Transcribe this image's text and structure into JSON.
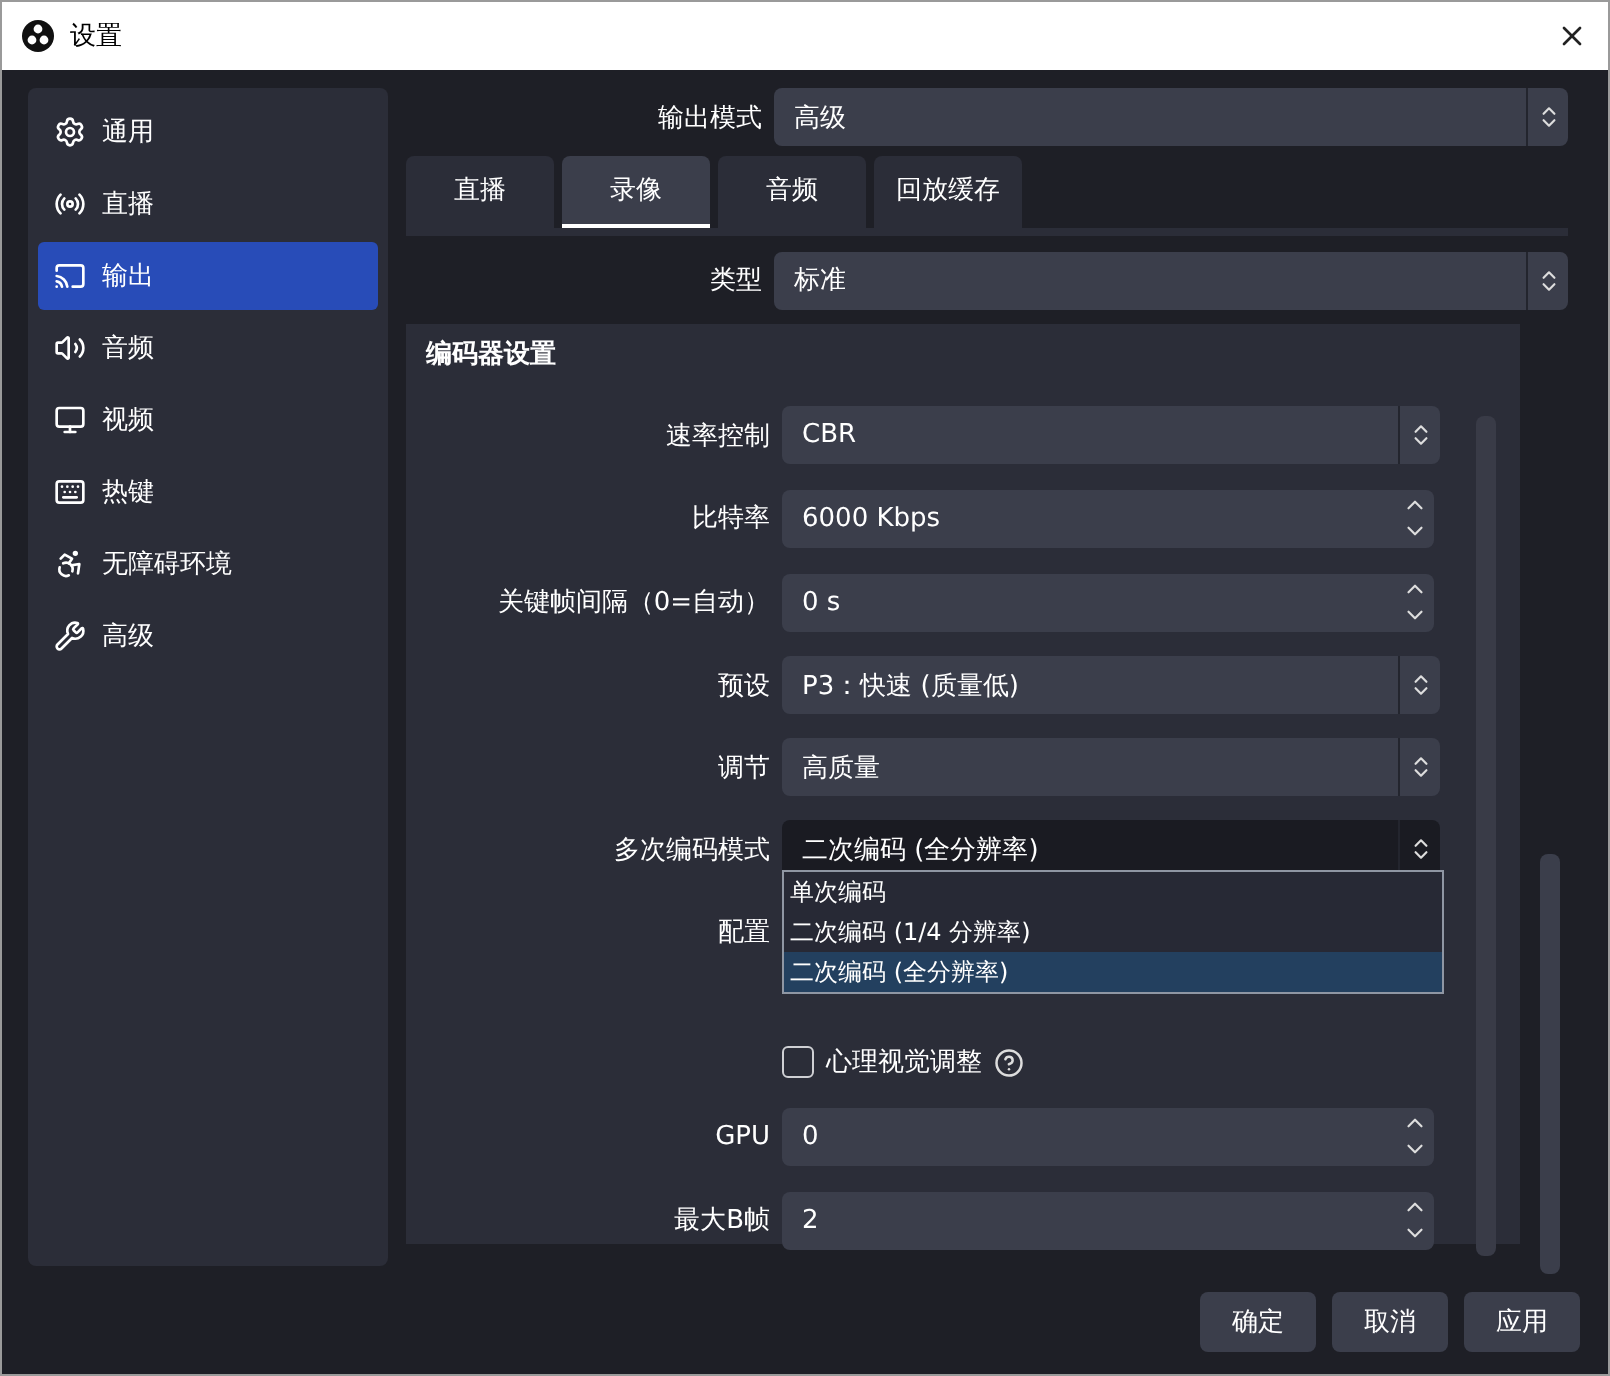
{
  "window": {
    "title": "设置"
  },
  "sidebar": {
    "items": [
      {
        "label": "通用",
        "selected": false
      },
      {
        "label": "直播",
        "selected": false
      },
      {
        "label": "输出",
        "selected": true
      },
      {
        "label": "音频",
        "selected": false
      },
      {
        "label": "视频",
        "selected": false
      },
      {
        "label": "热键",
        "selected": false
      },
      {
        "label": "无障碍环境",
        "selected": false
      },
      {
        "label": "高级",
        "selected": false
      }
    ]
  },
  "output_mode": {
    "label": "输出模式",
    "value": "高级"
  },
  "tabs": [
    {
      "label": "直播",
      "selected": false
    },
    {
      "label": "录像",
      "selected": true
    },
    {
      "label": "音频",
      "selected": false
    },
    {
      "label": "回放缓存",
      "selected": false
    }
  ],
  "type": {
    "label": "类型",
    "value": "标准"
  },
  "encoder_group": {
    "title": "编码器设置",
    "rows": [
      {
        "kind": "select",
        "label": "速率控制",
        "value": "CBR"
      },
      {
        "kind": "spin",
        "label": "比特率",
        "value": "6000 Kbps"
      },
      {
        "kind": "spin",
        "label": "关键帧间隔（0=自动）",
        "value": "0 s"
      },
      {
        "kind": "select",
        "label": "预设",
        "value": "P3：快速 (质量低)"
      },
      {
        "kind": "select",
        "label": "调节",
        "value": "高质量"
      },
      {
        "kind": "select",
        "label": "多次编码模式",
        "value": "二次编码 (全分辨率)",
        "open": true
      },
      {
        "kind": "covered",
        "label": "配置"
      },
      {
        "kind": "checkbox",
        "label": "心理视觉调整",
        "checked": false
      },
      {
        "kind": "spin",
        "label": "GPU",
        "value": "0"
      },
      {
        "kind": "spin",
        "label": "最大B帧",
        "value": "2"
      }
    ]
  },
  "dropdown": {
    "options": [
      {
        "label": "单次编码",
        "selected": false
      },
      {
        "label": "二次编码 (1/4 分辨率)",
        "selected": false
      },
      {
        "label": "二次编码 (全分辨率)",
        "selected": true
      }
    ]
  },
  "buttons": [
    "确定",
    "取消",
    "应用"
  ]
}
